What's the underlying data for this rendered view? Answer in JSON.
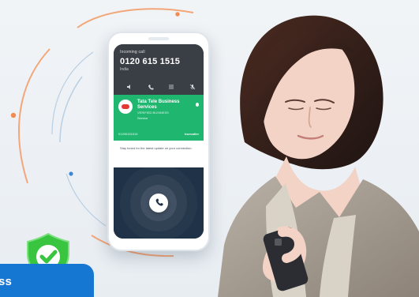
{
  "phone": {
    "call_status": "Incoming call",
    "phone_number": "0120 615 1515",
    "location": "India",
    "caller_name": "Tata Tele Business Services",
    "caller_subtitle": "VERIFIED BUSINESS",
    "caller_tag": "Service",
    "small_number": "01206151515",
    "brand": "truecaller",
    "message": "Stay tuned for the latest update on your connection."
  },
  "banner": {
    "text": "ss"
  },
  "icons": {
    "speaker": "speaker-icon",
    "phone": "phone-icon",
    "keypad": "keypad-icon",
    "mute": "mute-icon",
    "verified": "verified-icon",
    "shield": "shield-check-icon"
  },
  "colors": {
    "green": "#1fb66f",
    "blue": "#1677d2",
    "orange": "#f28b53",
    "shield_green": "#39c53f"
  }
}
